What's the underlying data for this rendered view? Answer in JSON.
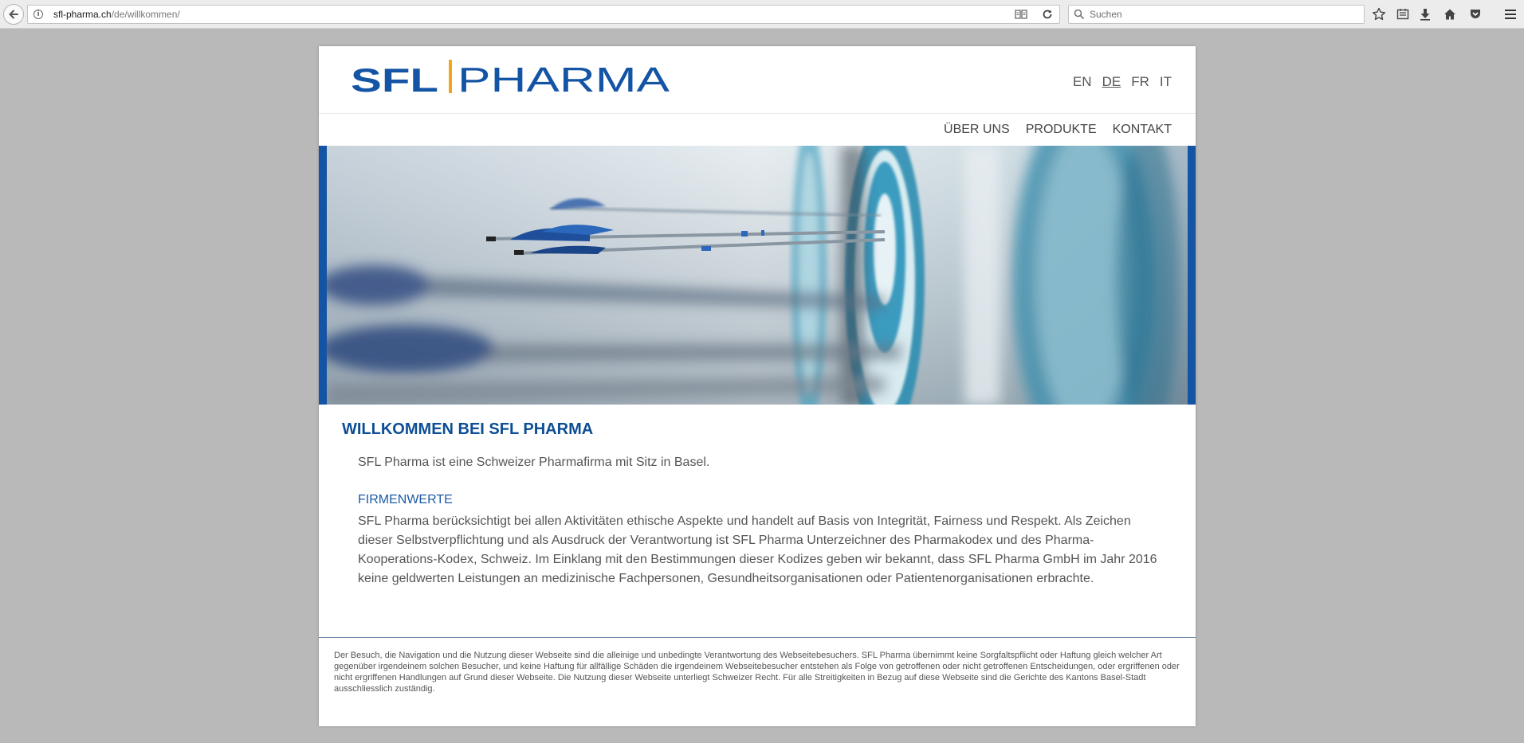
{
  "browser": {
    "url_host": "sfl-pharma.ch",
    "url_path": "/de/willkommen/",
    "search_placeholder": "Suchen"
  },
  "site": {
    "logo": {
      "part1": "SFL",
      "part2": "PHARMA"
    },
    "languages": [
      {
        "label": "EN",
        "active": false
      },
      {
        "label": "DE",
        "active": true
      },
      {
        "label": "FR",
        "active": false
      },
      {
        "label": "IT",
        "active": false
      }
    ],
    "nav": [
      "ÜBER UNS",
      "PRODUKTE",
      "KONTAKT"
    ],
    "heading": "WILLKOMMEN BEI SFL PHARMA",
    "intro": "SFL Pharma ist eine Schweizer Pharmafirma mit Sitz in Basel.",
    "values_heading": "FIRMENWERTE",
    "values_text": "SFL Pharma berücksichtigt bei allen Aktivitäten ethische Aspekte und handelt auf Basis von Integrität, Fairness und Respekt. Als Zeichen dieser Selbstverpflichtung und als Ausdruck der Verantwortung ist SFL Pharma Unterzeichner des Pharmakodex und des Pharma-Kooperations-Kodex, Schweiz. Im Einklang mit den Bestimmungen dieser Kodizes geben wir bekannt, dass SFL Pharma GmbH im Jahr 2016 keine geldwerten Leistungen an medizinische Fachpersonen, Gesundheitsorganisationen oder Patientenorganisationen erbrachte.",
    "disclaimer": "Der Besuch, die Navigation und die Nutzung dieser Webseite sind die alleinige und unbedingte Verantwortung des Webseitebesuchers. SFL Pharma übernimmt keine Sorgfaltspflicht oder Haftung gleich welcher Art gegenüber irgendeinem solchen Besucher, und keine Haftung für allfällige Schäden die irgendeinem Webseitebesucher entstehen als Folge von getroffenen oder nicht getroffenen Entscheidungen, oder ergriffenen oder nicht ergriffenen Handlungen auf Grund dieser Webseite. Die Nutzung dieser Webseite unterliegt Schweizer Recht. Für alle Streitigkeiten in Bezug auf diese Webseite sind die Gerichte des Kantons Basel-Stadt ausschliesslich zuständig."
  },
  "colors": {
    "brand_blue": "#1454a5",
    "logo_accent": "#f2a71b",
    "heading_blue": "#0d4e95"
  },
  "icons": [
    "back-arrow-icon",
    "info-icon",
    "reader-view-icon",
    "reload-icon",
    "search-icon",
    "bookmark-star-icon",
    "reading-list-icon",
    "download-icon",
    "home-icon",
    "pocket-icon",
    "menu-icon"
  ]
}
